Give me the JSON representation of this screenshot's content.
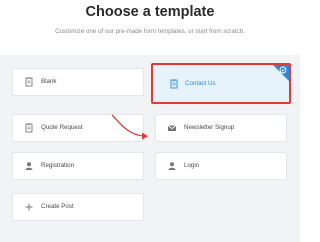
{
  "header": {
    "title": "Choose a template",
    "subtitle": "Customize one of our pre-made form templates, or start from scratch."
  },
  "templates": [
    {
      "label": "Blank",
      "icon": "document-icon",
      "selected": false
    },
    {
      "label": "Contact Us",
      "icon": "document-icon",
      "selected": true
    },
    {
      "label": "Quote Request",
      "icon": "document-icon",
      "selected": false
    },
    {
      "label": "Newsletter Signup",
      "icon": "envelope-icon",
      "selected": false
    },
    {
      "label": "Registration",
      "icon": "user-icon",
      "selected": false
    },
    {
      "label": "Login",
      "icon": "user-icon",
      "selected": false
    },
    {
      "label": "Create Post",
      "icon": "plus-icon",
      "selected": false
    }
  ],
  "colors": {
    "accent": "#2f86d6",
    "highlight": "#e53935",
    "selected_bg": "#e7f3fc",
    "panel_bg": "#f2f3f5"
  }
}
